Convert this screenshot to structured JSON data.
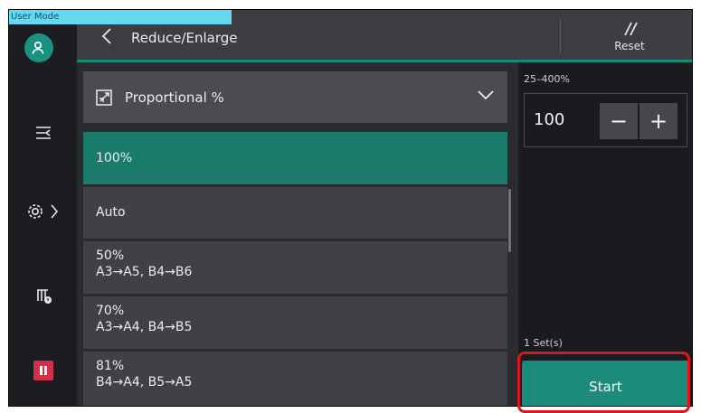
{
  "banner": {
    "user_mode": "User Mode"
  },
  "header": {
    "title": "Reduce/Enlarge",
    "reset_label": "Reset"
  },
  "dropdown": {
    "selected": "Proportional %"
  },
  "list": {
    "items": [
      {
        "line1": "100%",
        "line2": "",
        "selected": true
      },
      {
        "line1": "Auto",
        "line2": "",
        "selected": false
      },
      {
        "line1": "50%",
        "line2": "A3→A5, B4→B6",
        "selected": false
      },
      {
        "line1": "70%",
        "line2": "A3→A4, B4→B5",
        "selected": false
      },
      {
        "line1": "81%",
        "line2": "B4→A4, B5→A5",
        "selected": false
      }
    ]
  },
  "zoom": {
    "range": "25–400%",
    "value": "100",
    "minus": "−",
    "plus": "+"
  },
  "copies": {
    "sets": "1 Set(s)"
  },
  "actions": {
    "start": "Start"
  },
  "colors": {
    "accent": "#1a7a6c",
    "start": "#1c8b7b",
    "highlight": "#e0141c",
    "pause": "#d12f4a"
  }
}
